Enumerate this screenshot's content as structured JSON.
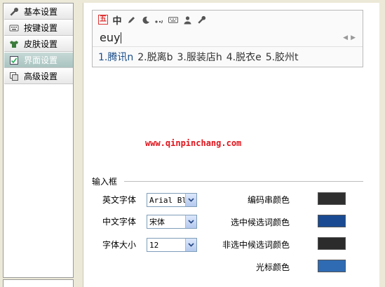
{
  "sidebar": {
    "items": [
      {
        "label": "基本设置",
        "icon": "wrench-icon"
      },
      {
        "label": "按键设置",
        "icon": "keyboard-icon"
      },
      {
        "label": "皮肤设置",
        "icon": "shirt-icon"
      },
      {
        "label": "界面设置",
        "icon": "checkbox-icon",
        "active": true
      },
      {
        "label": "高级设置",
        "icon": "layers-icon"
      }
    ]
  },
  "preview": {
    "toolbar_logo": "五",
    "toolbar_mode": "中",
    "pinyin": "euy",
    "candidates": [
      "1.腾讯n",
      "2.脱离b",
      "3.服装店h",
      "4.脱衣e",
      "5.胶州t"
    ]
  },
  "watermark": "www.qinpinchang.com",
  "input_box": {
    "title": "输入框",
    "english_font": {
      "label": "英文字体",
      "value": "Arial Bl"
    },
    "chinese_font": {
      "label": "中文字体",
      "value": "宋体"
    },
    "font_size": {
      "label": "字体大小",
      "value": "12"
    },
    "colors": [
      {
        "label": "编码串颜色",
        "color": "#2f2f2f"
      },
      {
        "label": "选中候选词颜色",
        "color": "#1a4b92"
      },
      {
        "label": "非选中候选词颜色",
        "color": "#2b2b2b"
      },
      {
        "label": "光标颜色",
        "color": "#2f6bb3"
      }
    ]
  }
}
